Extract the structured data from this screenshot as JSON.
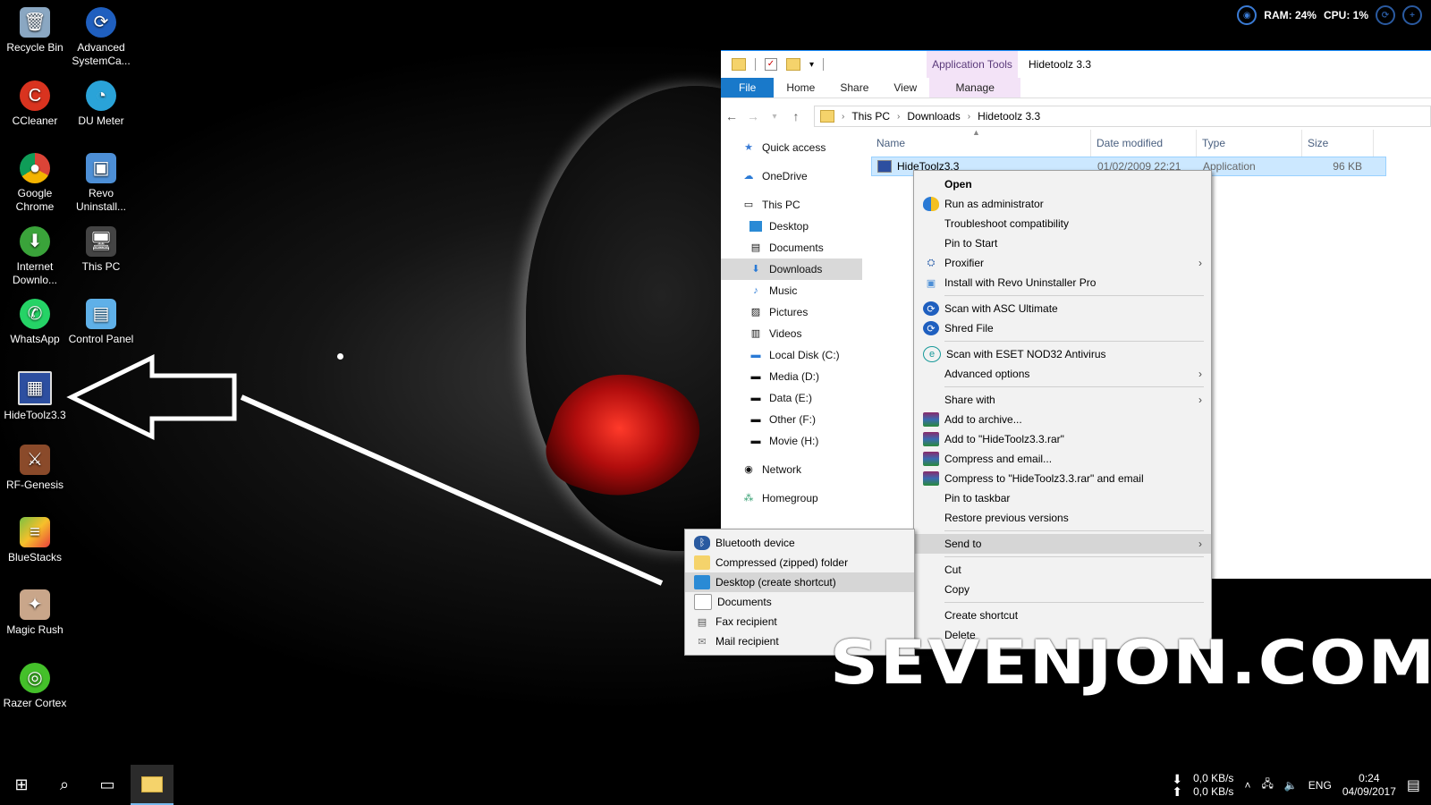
{
  "desktop": {
    "icons": [
      {
        "label": "Recycle Bin",
        "icon": "recycle-bin-icon"
      },
      {
        "label": "Advanced SystemCa...",
        "icon": "advanced-systemcare-icon"
      },
      {
        "label": "CCleaner",
        "icon": "ccleaner-icon"
      },
      {
        "label": "DU Meter",
        "icon": "du-meter-icon"
      },
      {
        "label": "Google Chrome",
        "icon": "chrome-icon"
      },
      {
        "label": "Revo Uninstall...",
        "icon": "revo-uninstaller-icon"
      },
      {
        "label": "Internet Downlo...",
        "icon": "idm-icon"
      },
      {
        "label": "This PC",
        "icon": "this-pc-icon"
      },
      {
        "label": "WhatsApp",
        "icon": "whatsapp-icon"
      },
      {
        "label": "Control Panel",
        "icon": "control-panel-icon"
      },
      {
        "label": "HideToolz3.3",
        "icon": "hidetoolz-icon"
      },
      {
        "label": "RF-Genesis",
        "icon": "rf-genesis-icon"
      },
      {
        "label": "BlueStacks",
        "icon": "bluestacks-icon"
      },
      {
        "label": "Magic Rush",
        "icon": "magic-rush-icon"
      },
      {
        "label": "Razer Cortex",
        "icon": "razer-cortex-icon"
      }
    ]
  },
  "gadget": {
    "ram": "RAM: 24%",
    "cpu": "CPU: 1%"
  },
  "explorer": {
    "context_tab_header": "Application Tools",
    "window_title": "Hidetoolz 3.3",
    "tabs": {
      "file": "File",
      "home": "Home",
      "share": "Share",
      "view": "View",
      "manage": "Manage"
    },
    "breadcrumb": [
      "This PC",
      "Downloads",
      "Hidetoolz 3.3"
    ],
    "nav": {
      "quick_access": "Quick access",
      "onedrive": "OneDrive",
      "this_pc": "This PC",
      "desktop": "Desktop",
      "documents": "Documents",
      "downloads": "Downloads",
      "music": "Music",
      "pictures": "Pictures",
      "videos": "Videos",
      "local_disk": "Local Disk (C:)",
      "media": "Media (D:)",
      "data": "Data (E:)",
      "other": "Other (F:)",
      "movie": "Movie (H:)",
      "network": "Network",
      "homegroup": "Homegroup"
    },
    "columns": {
      "name": "Name",
      "date": "Date modified",
      "type": "Type",
      "size": "Size"
    },
    "file": {
      "name": "HideToolz3.3",
      "date": "01/02/2009 22:21",
      "type": "Application",
      "size": "96 KB"
    }
  },
  "context_menu": {
    "open": "Open",
    "run_as_admin": "Run as administrator",
    "troubleshoot": "Troubleshoot compatibility",
    "pin_start": "Pin to Start",
    "proxifier": "Proxifier",
    "revo": "Install with Revo Uninstaller Pro",
    "asc": "Scan with ASC Ultimate",
    "shred": "Shred File",
    "eset": "Scan with ESET NOD32 Antivirus",
    "advanced": "Advanced options",
    "share_with": "Share with",
    "add_archive": "Add to archive...",
    "add_rar": "Add to \"HideToolz3.3.rar\"",
    "compress_email": "Compress and email...",
    "compress_rar_email": "Compress to \"HideToolz3.3.rar\" and email",
    "pin_taskbar": "Pin to taskbar",
    "restore": "Restore previous versions",
    "send_to": "Send to",
    "cut": "Cut",
    "copy": "Copy",
    "create_shortcut": "Create shortcut",
    "delete": "Delete"
  },
  "send_to_menu": {
    "bluetooth": "Bluetooth device",
    "zip": "Compressed (zipped) folder",
    "desktop": "Desktop (create shortcut)",
    "documents": "Documents",
    "fax": "Fax recipient",
    "mail": "Mail recipient"
  },
  "watermark": "SEVENJON.COM",
  "taskbar": {
    "net_down": "0,0 KB/s",
    "net_up": "0,0 KB/s",
    "lang": "ENG",
    "time": "0:24",
    "date": "04/09/2017"
  },
  "colors": {
    "accent": "#1979ca",
    "selection": "#cce8ff",
    "context_tab": "#f3e3f7"
  }
}
